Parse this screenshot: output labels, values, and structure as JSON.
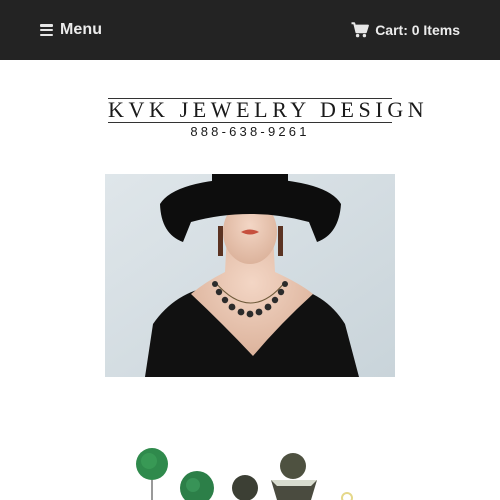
{
  "header": {
    "menu_label": "Menu",
    "cart_label": "Cart: 0 Items",
    "menu_icon": "hamburger-icon",
    "cart_icon": "shopping-cart-icon"
  },
  "logo": {
    "brand": "KVK JEWELRY DESIGN",
    "phone": "888-638-9261"
  },
  "hero": {
    "subject": "model-in-black-hat-with-necklace"
  },
  "product_preview": {
    "subject": "earrings-assortment"
  },
  "colors": {
    "topbar": "#232323",
    "topbar_text": "#ececec",
    "background": "#ffffff"
  }
}
